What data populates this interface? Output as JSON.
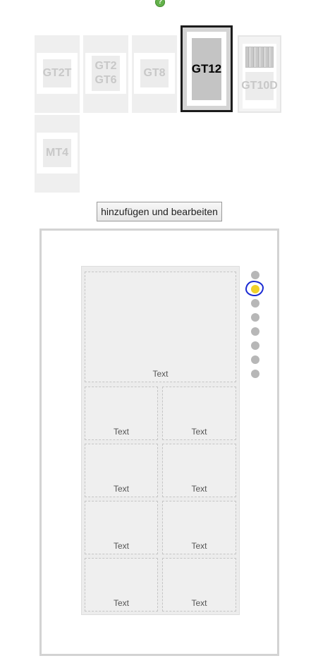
{
  "help": {
    "icon": "?"
  },
  "devices": [
    {
      "id": "gt2t",
      "label": "GT2T"
    },
    {
      "id": "gt2gt6",
      "label_line1": "GT2",
      "label_line2": "GT6"
    },
    {
      "id": "gt8",
      "label": "GT8"
    },
    {
      "id": "gt12",
      "label": "GT12"
    },
    {
      "id": "gt10d",
      "label": "GT10D"
    },
    {
      "id": "mt4",
      "label": "MT4"
    }
  ],
  "action": {
    "label": "hinzufügen und bearbeiten"
  },
  "editor": {
    "slots": [
      {
        "label": "Text"
      },
      {
        "label": "Text"
      },
      {
        "label": "Text"
      },
      {
        "label": "Text"
      },
      {
        "label": "Text"
      },
      {
        "label": "Text"
      },
      {
        "label": "Text"
      },
      {
        "label": "Text"
      },
      {
        "label": "Text"
      }
    ],
    "pages": {
      "count": 8,
      "active_index": 1
    }
  },
  "colors": {
    "accent": "#f1d12a",
    "selection_ring": "#1a2ad3",
    "help": "#63b14a"
  }
}
